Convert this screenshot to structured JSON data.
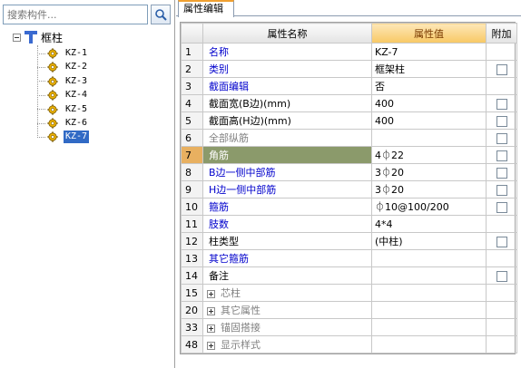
{
  "search": {
    "placeholder": "搜索构件..."
  },
  "tree": {
    "root_label": "框柱",
    "items": [
      "KZ-1",
      "KZ-2",
      "KZ-3",
      "KZ-4",
      "KZ-5",
      "KZ-6",
      "KZ-7"
    ],
    "selected_index": 6
  },
  "tab": {
    "label": "属性编辑"
  },
  "grid": {
    "headers": {
      "index": "",
      "name": "属性名称",
      "value": "属性值",
      "extra": "附加"
    },
    "rows": [
      {
        "num": "1",
        "name": "名称",
        "value": "KZ-7",
        "style": "blue",
        "checkbox": false
      },
      {
        "num": "2",
        "name": "类别",
        "value": "框架柱",
        "style": "blue",
        "checkbox": true
      },
      {
        "num": "3",
        "name": "截面编辑",
        "value": "否",
        "style": "blue",
        "checkbox": false
      },
      {
        "num": "4",
        "name": "截面宽(B边)(mm)",
        "value": "400",
        "style": "black",
        "checkbox": true
      },
      {
        "num": "5",
        "name": "截面高(H边)(mm)",
        "value": "400",
        "style": "black",
        "checkbox": true
      },
      {
        "num": "6",
        "name": "全部纵筋",
        "value": "",
        "style": "grey",
        "checkbox": true
      },
      {
        "num": "7",
        "name": "角筋",
        "value": "4⏀22",
        "style": "selected",
        "checkbox": true
      },
      {
        "num": "8",
        "name": "B边一侧中部筋",
        "value": "3⏀20",
        "style": "blue",
        "checkbox": true
      },
      {
        "num": "9",
        "name": "H边一侧中部筋",
        "value": "3⏀20",
        "style": "blue",
        "checkbox": true
      },
      {
        "num": "10",
        "name": "箍筋",
        "value": "⏀10@100/200",
        "style": "blue",
        "checkbox": true
      },
      {
        "num": "11",
        "name": "肢数",
        "value": "4*4",
        "style": "blue",
        "checkbox": false
      },
      {
        "num": "12",
        "name": "柱类型",
        "value": "(中柱)",
        "style": "black",
        "checkbox": true
      },
      {
        "num": "13",
        "name": "其它箍筋",
        "value": "",
        "style": "blue",
        "checkbox": false
      },
      {
        "num": "14",
        "name": "备注",
        "value": "",
        "style": "black",
        "checkbox": true
      },
      {
        "num": "15",
        "name": "芯柱",
        "value": "",
        "style": "group",
        "checkbox": false
      },
      {
        "num": "20",
        "name": "其它属性",
        "value": "",
        "style": "group",
        "checkbox": false
      },
      {
        "num": "33",
        "name": "锚固搭接",
        "value": "",
        "style": "group",
        "checkbox": false
      },
      {
        "num": "48",
        "name": "显示样式",
        "value": "",
        "style": "group",
        "checkbox": false
      }
    ]
  },
  "colors": {
    "accent_header": "#f8c864",
    "selection": "#316ac5",
    "selected_name": "#8b9a6b",
    "link_text": "#0000cc"
  },
  "icons": {
    "search": "magnifier-icon",
    "column_type": "column-t-icon",
    "component": "gear-icon"
  }
}
